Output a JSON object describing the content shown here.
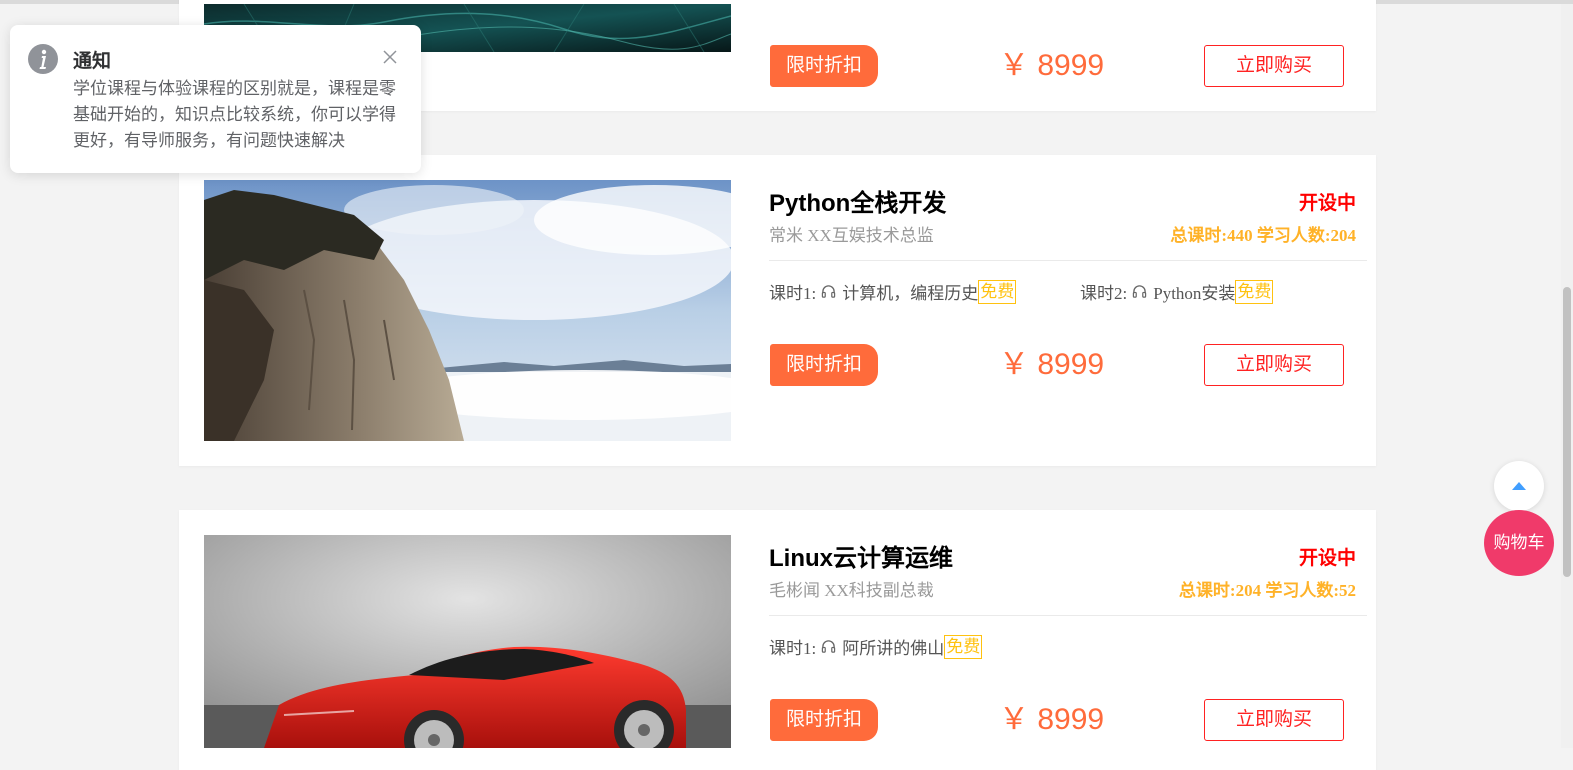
{
  "notification": {
    "title": "通知",
    "icon": "info-icon",
    "body": "学位课程与体验课程的区别就是，课程是零基础开始的，知识点比较系统，你可以学得更好，有导师服务，有问题快速解决"
  },
  "courses": [
    {
      "title": "",
      "sale_label": "限时折扣",
      "price": "￥ 8999",
      "buy_label": "立即购买"
    },
    {
      "title": "Python全栈开发",
      "teacher": "常米 XX互娱技术总监",
      "status": "开设中",
      "stats": "总课时:440 学习人数:204",
      "lessons": [
        {
          "label": "课时1:",
          "name": "计算机，编程历史",
          "tag": "免费"
        },
        {
          "label": "课时2:",
          "name": "Python安装",
          "tag": "免费"
        }
      ],
      "sale_label": "限时折扣",
      "price": "￥ 8999",
      "buy_label": "立即购买"
    },
    {
      "title": "Linux云计算运维",
      "teacher": "毛彬闻 XX科技副总裁",
      "status": "开设中",
      "stats": "总课时:204 学习人数:52",
      "lessons": [
        {
          "label": "课时1:",
          "name": "阿所讲的佛山",
          "tag": "免费"
        }
      ],
      "sale_label": "限时折扣",
      "price": "￥ 8999",
      "buy_label": "立即购买"
    }
  ],
  "cart_label": "购物车",
  "colors": {
    "accent": "#ff6b3b",
    "buy_border": "#ff2222",
    "status": "#ff0000",
    "stats": "#ffb228",
    "free_tag": "#ffc210",
    "cart": "#f03a6a",
    "back_top_arrow": "#409eff"
  }
}
